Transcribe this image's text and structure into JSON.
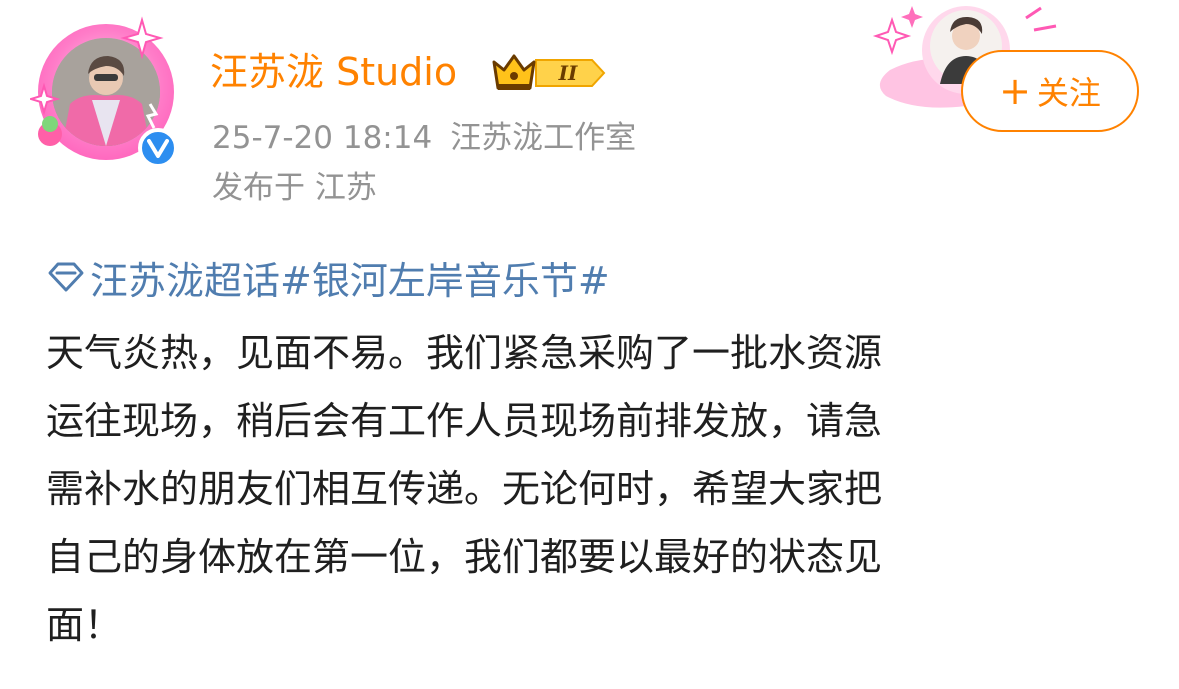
{
  "header": {
    "user_name": "汪苏泷 Studio",
    "vip_level": "II",
    "timestamp": "25-7-20 18:14",
    "source": "汪苏泷工作室",
    "location": "发布于 江苏",
    "follow_label": "关注",
    "follow_plus": "+"
  },
  "post": {
    "topics": "汪苏泷超话#银河左岸音乐节#",
    "lines": [
      "天气炎热，见面不易。我们紧急采购了一批水资源",
      "运往现场，稍后会有工作人员现场前排发放，请急",
      "需补水的朋友们相互传递。无论何时，希望大家把",
      "自己的身体放在第一位，我们都要以最好的状态见",
      "面！"
    ]
  },
  "colors": {
    "name": "#ff8200",
    "follow": "#ff8200",
    "meta": "#939393",
    "topic": "#507daf",
    "verified": "#2d8ef0"
  },
  "icons": {
    "verified": "verified-v-icon",
    "supertopic": "supertopic-diamond-icon",
    "vip": "crown-icon"
  }
}
